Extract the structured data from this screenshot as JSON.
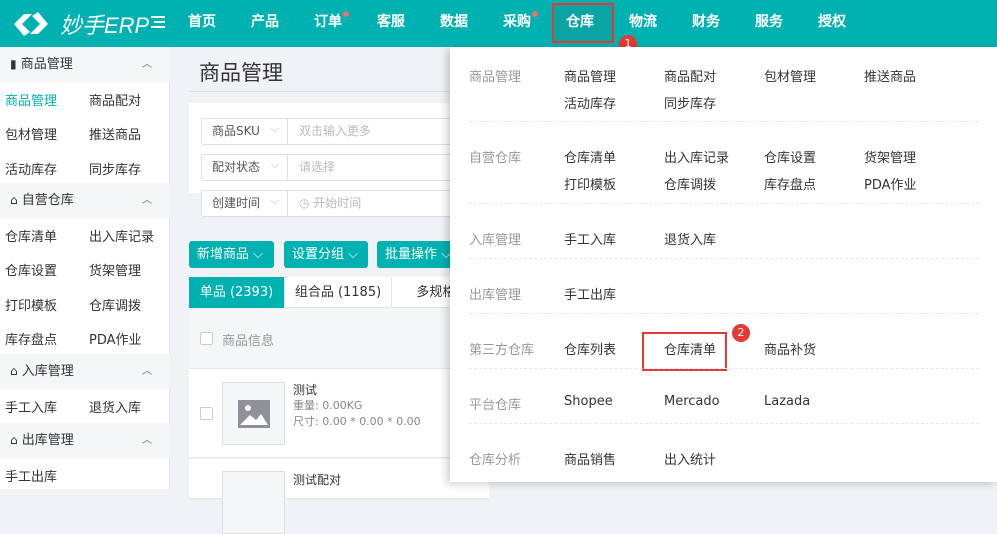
{
  "app": {
    "logo_text": "妙手ERP"
  },
  "nav": [
    {
      "label": "首页"
    },
    {
      "label": "产品"
    },
    {
      "label": "订单",
      "dot": true
    },
    {
      "label": "客服"
    },
    {
      "label": "数据"
    },
    {
      "label": "采购",
      "dot": true
    },
    {
      "label": "仓库",
      "active": true
    },
    {
      "label": "物流"
    },
    {
      "label": "财务"
    },
    {
      "label": "服务"
    },
    {
      "label": "授权"
    }
  ],
  "badges": [
    "1",
    "2"
  ],
  "sidebar": {
    "groups": [
      {
        "title": "商品管理",
        "items": [
          "商品管理",
          "商品配对",
          "包材管理",
          "推送商品",
          "活动库存",
          "同步库存"
        ]
      },
      {
        "title": "自营仓库",
        "items": [
          "仓库清单",
          "出入库记录",
          "仓库设置",
          "货架管理",
          "打印模板",
          "仓库调拨",
          "库存盘点",
          "PDA作业"
        ]
      },
      {
        "title": "入库管理",
        "items": [
          "手工入库",
          "退货入库"
        ]
      },
      {
        "title": "出库管理",
        "items": [
          "手工出库"
        ]
      }
    ]
  },
  "main": {
    "title": "商品管理",
    "filters": [
      {
        "select": "商品SKU",
        "placeholder": "双击输入更多"
      },
      {
        "select": "配对状态",
        "placeholder": "请选择"
      },
      {
        "select": "创建时间",
        "placeholder": "开始时间"
      }
    ],
    "buttons": [
      "新增商品",
      "设置分组",
      "批量操作"
    ],
    "tabs": [
      "单品 (2393)",
      "组合品 (1185)",
      "多规格 ("
    ],
    "table_header": "商品信息",
    "rows": [
      {
        "name": "测试",
        "weight": "重量: 0.00KG",
        "size": "尺寸: 0.00 * 0.00 * 0.00"
      },
      {
        "name": "测试配对"
      }
    ]
  },
  "dropdown": {
    "sections": [
      {
        "label": "商品管理",
        "items": [
          "商品管理",
          "商品配对",
          "包材管理",
          "推送商品",
          "活动库存",
          "同步库存"
        ]
      },
      {
        "label": "自营仓库",
        "items": [
          "仓库清单",
          "出入库记录",
          "仓库设置",
          "货架管理",
          "打印模板",
          "仓库调拨",
          "库存盘点",
          "PDA作业"
        ]
      },
      {
        "label": "入库管理",
        "items": [
          "手工入库",
          "退货入库"
        ]
      },
      {
        "label": "出库管理",
        "items": [
          "手工出库"
        ]
      },
      {
        "label": "第三方仓库",
        "items": [
          "仓库列表",
          "仓库清单",
          "商品补货"
        ]
      },
      {
        "label": "平台仓库",
        "items": [
          "Shopee",
          "Mercado",
          "Lazada"
        ]
      },
      {
        "label": "仓库分析",
        "items": [
          "商品销售",
          "出入统计"
        ]
      }
    ]
  },
  "colors": {
    "brand": "#00b1b2",
    "highlight": "#e53935"
  }
}
